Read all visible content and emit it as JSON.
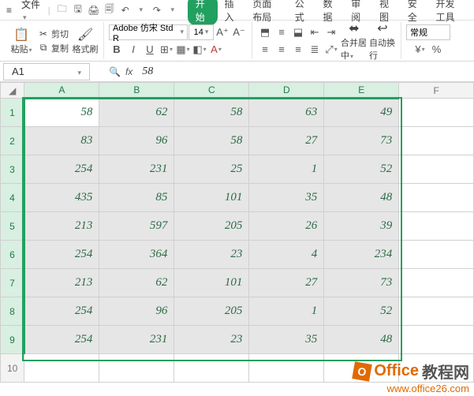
{
  "menu": {
    "file_label": "文件",
    "qat_icons": [
      "folder-icon",
      "save-icon",
      "print-icon",
      "preview-icon",
      "undo-icon",
      "redo-icon"
    ],
    "tabs": [
      "开始",
      "插入",
      "页面布局",
      "公式",
      "数据",
      "审阅",
      "视图",
      "安全",
      "开发工具"
    ],
    "active_tab_index": 0
  },
  "ribbon": {
    "paste_label": "粘贴",
    "cut_label": "剪切",
    "copy_label": "复制",
    "format_painter_label": "格式刷",
    "font_name": "Adobe 仿宋 Std R",
    "font_size": "14",
    "merge_center_label": "合并居中",
    "wrap_text_label": "自动换行",
    "styles_label": "常规"
  },
  "formula": {
    "cell_ref": "A1",
    "value": "58"
  },
  "sheet": {
    "col_headers": [
      "A",
      "B",
      "C",
      "D",
      "E",
      "F"
    ],
    "row_headers": [
      "1",
      "2",
      "3",
      "4",
      "5",
      "6",
      "7",
      "8",
      "9",
      "10"
    ],
    "selected_cols": 5,
    "selected_rows": 9,
    "rows": [
      [
        58,
        62,
        58,
        63,
        49
      ],
      [
        83,
        96,
        58,
        27,
        73
      ],
      [
        254,
        231,
        25,
        1,
        52
      ],
      [
        435,
        85,
        101,
        35,
        48
      ],
      [
        213,
        597,
        205,
        26,
        39
      ],
      [
        254,
        364,
        23,
        4,
        234
      ],
      [
        213,
        62,
        101,
        27,
        73
      ],
      [
        254,
        96,
        205,
        1,
        52
      ],
      [
        254,
        231,
        23,
        35,
        48
      ]
    ]
  },
  "watermark": {
    "title_main": "Office",
    "title_cn": "教程网",
    "url": "www.office26.com"
  }
}
